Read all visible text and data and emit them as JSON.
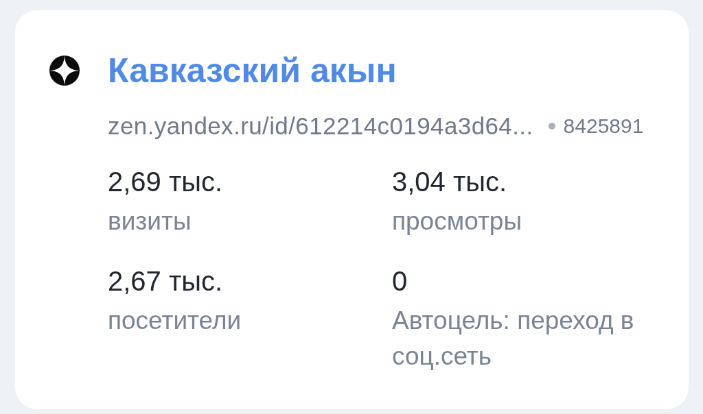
{
  "counter": {
    "title": "Кавказский акын",
    "url": "zen.yandex.ru/id/612214c0194a3d64...",
    "id": "8425891"
  },
  "metrics": [
    {
      "value": "2,69 тыс.",
      "label": "визиты"
    },
    {
      "value": "3,04 тыс.",
      "label": "просмотры"
    },
    {
      "value": "2,67 тыс.",
      "label": "посетители"
    },
    {
      "value": "0",
      "label": "Автоцель: переход в соц.сеть"
    }
  ]
}
